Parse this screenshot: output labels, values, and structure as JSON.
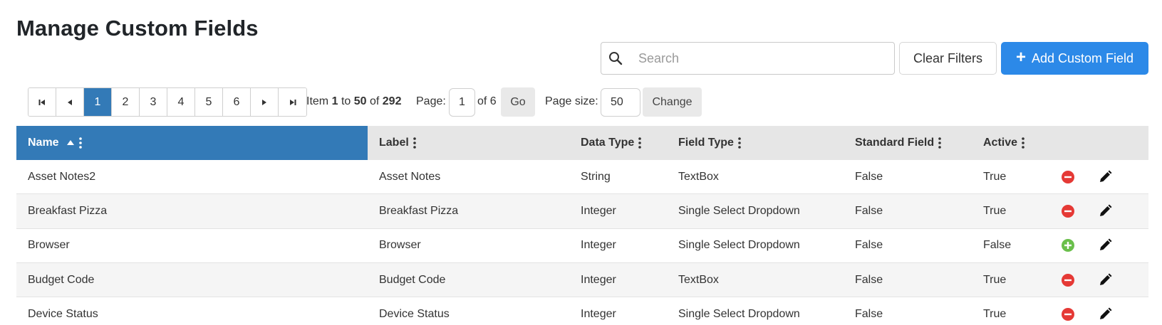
{
  "page": {
    "title": "Manage Custom Fields"
  },
  "toolbar": {
    "search_placeholder": "Search",
    "search_value": "",
    "clear_filters_label": "Clear Filters",
    "add_label": "Add Custom Field",
    "add_icon": "plus-icon"
  },
  "pager": {
    "pages": [
      "1",
      "2",
      "3",
      "4",
      "5",
      "6"
    ],
    "active_page": "1",
    "item_prefix": "Item",
    "item_from": "1",
    "item_to_word": "to",
    "item_to": "50",
    "item_of_word": "of",
    "item_total": "292",
    "page_label": "Page:",
    "page_value": "1",
    "page_of": "of 6",
    "go_label": "Go",
    "size_label": "Page size:",
    "size_value": "50",
    "change_label": "Change"
  },
  "table": {
    "columns": [
      "Name",
      "Label",
      "Data Type",
      "Field Type",
      "Standard Field",
      "Active"
    ],
    "sorted_column": "Name",
    "sort_direction": "ascending",
    "rows": [
      {
        "name": "Asset Notes2",
        "label": "Asset Notes",
        "data_type": "String",
        "field_type": "TextBox",
        "standard": "False",
        "active": "True",
        "toggle_icon": "deactivate-icon"
      },
      {
        "name": "Breakfast Pizza",
        "label": "Breakfast Pizza",
        "data_type": "Integer",
        "field_type": "Single Select Dropdown",
        "standard": "False",
        "active": "True",
        "toggle_icon": "deactivate-icon"
      },
      {
        "name": "Browser",
        "label": "Browser",
        "data_type": "Integer",
        "field_type": "Single Select Dropdown",
        "standard": "False",
        "active": "False",
        "toggle_icon": "activate-icon"
      },
      {
        "name": "Budget Code",
        "label": "Budget Code",
        "data_type": "Integer",
        "field_type": "TextBox",
        "standard": "False",
        "active": "True",
        "toggle_icon": "deactivate-icon"
      },
      {
        "name": "Device Status",
        "label": "Device Status",
        "data_type": "Integer",
        "field_type": "Single Select Dropdown",
        "standard": "False",
        "active": "True",
        "toggle_icon": "deactivate-icon"
      }
    ]
  },
  "colors": {
    "primary": "#2c89e8",
    "header_sorted": "#337ab7",
    "deactivate": "#e53935",
    "activate": "#6abf4b"
  }
}
